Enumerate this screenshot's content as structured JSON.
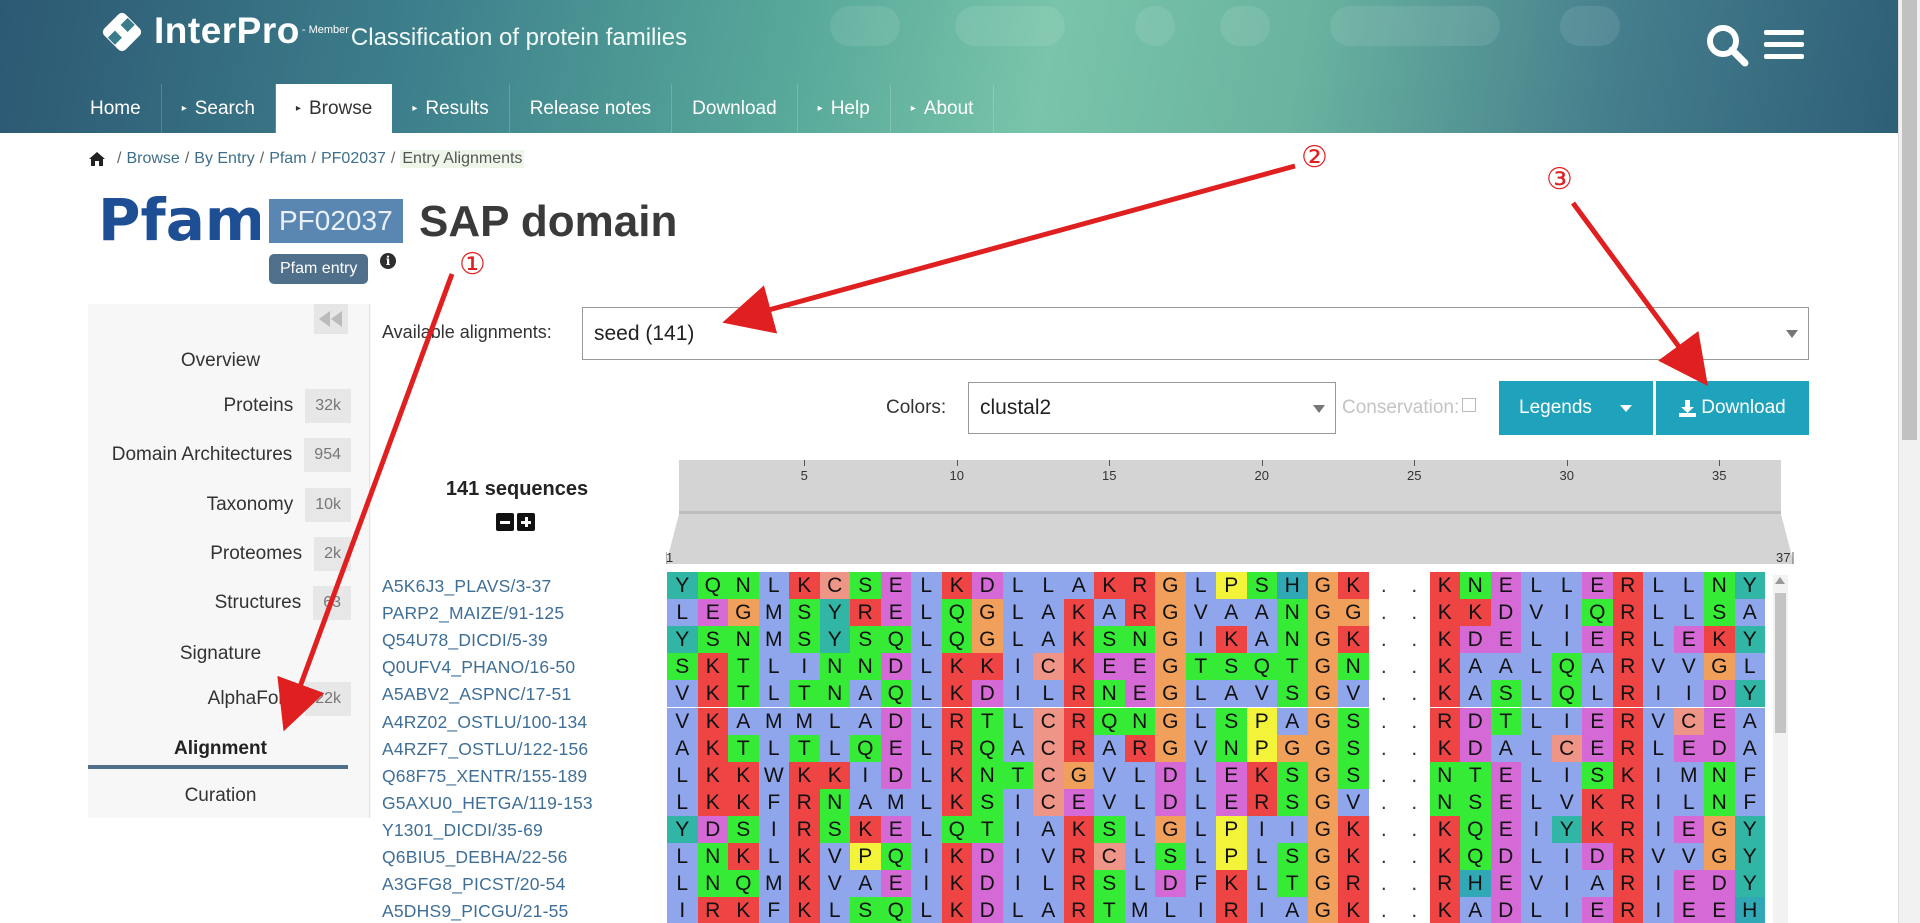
{
  "header": {
    "brand": "InterPro",
    "member": "- Member",
    "subtitle": "Classification of protein families"
  },
  "nav": [
    {
      "label": "Home",
      "arrow": false
    },
    {
      "label": "Search",
      "arrow": true
    },
    {
      "label": "Browse",
      "arrow": true,
      "active": true
    },
    {
      "label": "Results",
      "arrow": true
    },
    {
      "label": "Release notes",
      "arrow": false
    },
    {
      "label": "Download",
      "arrow": false
    },
    {
      "label": "Help",
      "arrow": true
    },
    {
      "label": "About",
      "arrow": true
    }
  ],
  "breadcrumb": [
    "Browse",
    "By Entry",
    "Pfam",
    "PF02037",
    "Entry Alignments"
  ],
  "entry": {
    "database": "Pfam",
    "accession": "PF02037",
    "name": "SAP domain",
    "type_badge": "Pfam entry",
    "info_icon": "i"
  },
  "sidebar": {
    "items": [
      {
        "label": "Overview",
        "count": null
      },
      {
        "label": "Proteins",
        "count": "32k"
      },
      {
        "label": "Domain Architectures",
        "count": "954"
      },
      {
        "label": "Taxonomy",
        "count": "10k"
      },
      {
        "label": "Proteomes",
        "count": "2k"
      },
      {
        "label": "Structures",
        "count": "63"
      },
      {
        "label": "Signature",
        "count": null
      },
      {
        "label": "AlphaFold",
        "count": "22k"
      },
      {
        "label": "Alignment",
        "count": null,
        "active": true
      },
      {
        "label": "Curation",
        "count": null
      }
    ]
  },
  "controls": {
    "available_label": "Available alignments:",
    "available_value": "seed (141)",
    "colors_label": "Colors:",
    "colors_value": "clustal2",
    "conservation_label": "Conservation:",
    "legends_label": "Legends",
    "download_label": "Download"
  },
  "alignment": {
    "sequence_count": "141 sequences",
    "ruler_ticks": [
      "5",
      "10",
      "15",
      "20",
      "25",
      "30",
      "35"
    ],
    "ruler_start": "1",
    "ruler_end": "37",
    "names": [
      "A5K6J3_PLAVS/3-37",
      "PARP2_MAIZE/91-125",
      "Q54U78_DICDI/5-39",
      "Q0UFV4_PHANO/16-50",
      "A5ABV2_ASPNC/17-51",
      "A4RZ02_OSTLU/100-134",
      "A4RZF7_OSTLU/122-156",
      "Q68F75_XENTR/155-189",
      "G5AXU0_HETGA/119-153",
      "Y1301_DICDI/35-69",
      "Q6BIU5_DEBHA/22-56",
      "A3GFG8_PICST/20-54",
      "A5DHS9_PICGU/21-55"
    ],
    "rows": [
      "YQNLKCSELKDLLAKRGLPSHGK..KNELLERLLNY",
      "LEGMSYRELQGLAKARGVAANGG..KKDVIQRLLSA",
      "YSNMSYSQLQGLAKSNGIKANGK..KDELIERLEKY",
      "SKTLINNDLKKICKEEGTSQTGN..KAALQARVVGL",
      "VKTLTNAQLKDILRNEGLAVSGV..KASLQLRIIDY",
      "VKAMMLADLRTLCRQNGLSPAGS..RDTLIERVCEA",
      "AKTLTLQELRQACRARGVNPGGS..KDALCERLEDA",
      "LKKWKKIDLKNTCGVLDLEKSGS..NTELISKIMNF",
      "LKKFRNAMLKSICEVLDLERSGV..NSELVKRILNF",
      "YDSIRSKELQTIAKSLGLPIIGK..KQEIYKRIEGY",
      "LNKLKVPQIKDIVRCLSLPLSGK..KQDLIDRVVGY",
      "LNQMKVAEIKDILRSLDFKLTGR..RHEVIARIEDY",
      "IRKFKLSQLKDLARTMLIRIAGK..KADLIERIEEH"
    ],
    "colors": {
      "A": "#8fa6ec",
      "I": "#8fa6ec",
      "L": "#8fa6ec",
      "M": "#8fa6ec",
      "F": "#8fa6ec",
      "W": "#8fa6ec",
      "V": "#8fa6ec",
      "C": "#ef9587",
      "K": "#ef4444",
      "R": "#ef4444",
      "E": "#d56ad6",
      "D": "#d56ad6",
      "N": "#35eb35",
      "Q": "#35eb35",
      "S": "#35eb35",
      "T": "#35eb35",
      "G": "#f0a05a",
      "P": "#f3f33a",
      "H": "#31a8b5",
      "Y": "#31b5a5",
      ".": "#ffffff"
    }
  },
  "annotations": [
    "①",
    "②",
    "③"
  ]
}
